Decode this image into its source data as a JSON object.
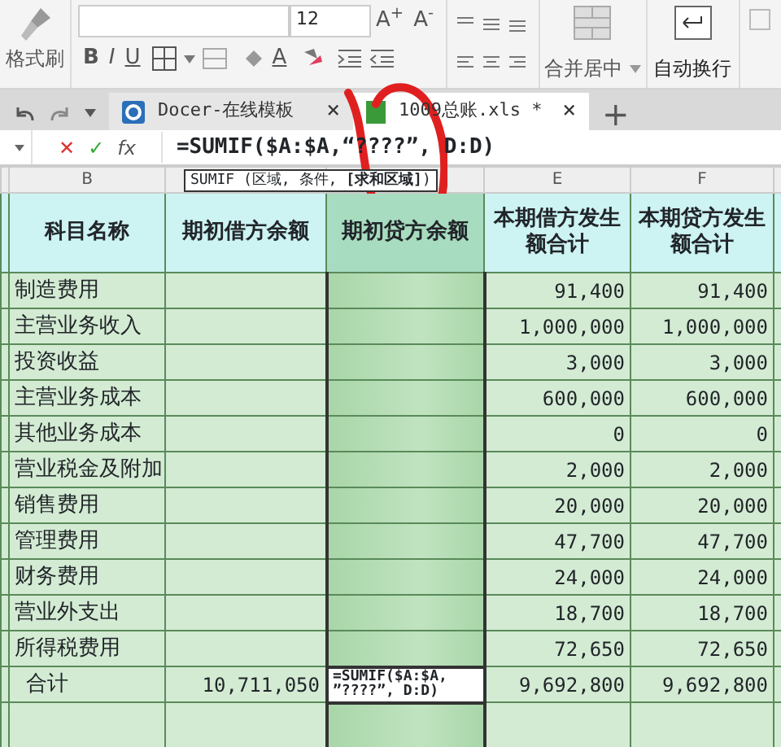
{
  "ribbon": {
    "format_painter": "格式刷",
    "font_size": "12",
    "grow_font": "A$^{+}$",
    "shrink_font": "A$^{-}$",
    "bold": "B",
    "italic": "I",
    "underline": "U",
    "font_color": "A",
    "merge": "合并居中",
    "wrap": "自动换行"
  },
  "tabs": [
    {
      "label": "Docer-在线模板",
      "close": "×",
      "selected": false
    },
    {
      "label": "1009总账.xls *",
      "close": "×",
      "selected": true
    }
  ],
  "new_tab": "+",
  "formula_bar": {
    "cancel": "✕",
    "enter": "✓",
    "fx": "fx",
    "formula": "=SUMIF($A:$A,“????”, D:D)"
  },
  "tooltip": "SUMIF (区域, 条件, **[求和区域]**)",
  "column_letters": {
    "b": "B",
    "e": "E",
    "f": "F"
  },
  "columns": [
    {
      "title": "科目名称",
      "selected": false
    },
    {
      "title": "期初借方余额",
      "selected": false
    },
    {
      "title": "期初贷方余额",
      "selected": true
    },
    {
      "title": "本期借方发生额合计",
      "selected": false
    },
    {
      "title": "本期贷方发生额合计",
      "selected": false
    }
  ],
  "rows": [
    {
      "account": "制造费用",
      "debit_total": "91,400",
      "credit_total": "91,400"
    },
    {
      "account": "主营业务收入",
      "debit_total": "1,000,000",
      "credit_total": "1,000,000"
    },
    {
      "account": "投资收益",
      "debit_total": "3,000",
      "credit_total": "3,000"
    },
    {
      "account": "主营业务成本",
      "debit_total": "600,000",
      "credit_total": "600,000"
    },
    {
      "account": "其他业务成本",
      "debit_total": "0",
      "credit_total": "0"
    },
    {
      "account": "营业税金及附加",
      "debit_total": "2,000",
      "credit_total": "2,000"
    },
    {
      "account": "销售费用",
      "debit_total": "20,000",
      "credit_total": "20,000"
    },
    {
      "account": "管理费用",
      "debit_total": "47,700",
      "credit_total": "47,700"
    },
    {
      "account": "财务费用",
      "debit_total": "24,000",
      "credit_total": "24,000"
    },
    {
      "account": "营业外支出",
      "debit_total": "18,700",
      "credit_total": "18,700"
    },
    {
      "account": "所得税费用",
      "debit_total": "72,650",
      "credit_total": "72,650"
    }
  ],
  "total_row": {
    "account": "合计",
    "opening_debit": "10,711,050",
    "editing_formula": "=SUMIF($A:$A,\n”????”, D:D)",
    "debit_total": "9,692,800",
    "credit_total": "9,692,800"
  }
}
